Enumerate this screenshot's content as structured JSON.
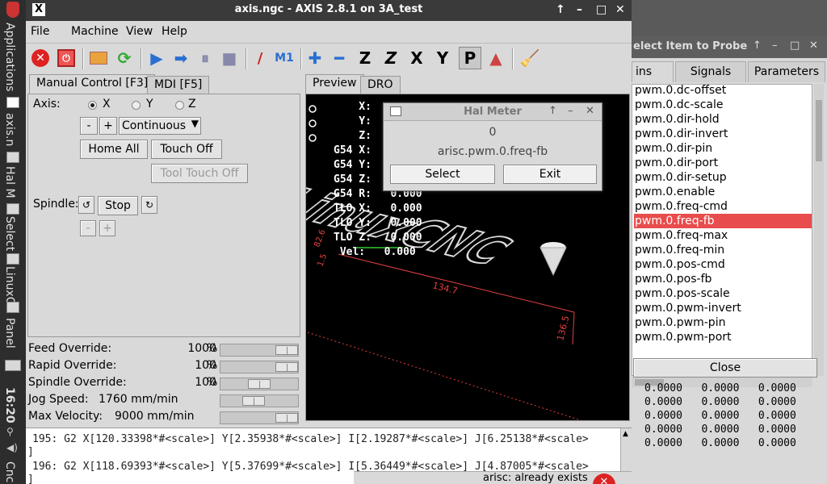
{
  "taskbar": {
    "items": [
      "Applications",
      "axis.n",
      "Hal M",
      "Select",
      "LinuxC",
      "Panel"
    ],
    "clock": "16:20",
    "last_item": "Cnc"
  },
  "axis": {
    "title": "axis.ngc - AXIS 2.8.1 on 3A_test",
    "menus": [
      "File",
      "Machine",
      "View",
      "Help"
    ],
    "toolbar_letters": {
      "z": "Z",
      "x": "X",
      "y": "Y",
      "p": "P"
    },
    "tabs": {
      "manual": "Manual Control [F3]",
      "mdi": "MDI [F5]",
      "preview": "Preview",
      "dro": "DRO"
    },
    "manual": {
      "axis_label": "Axis:",
      "axes": [
        "X",
        "Y",
        "Z"
      ],
      "minus": "-",
      "plus": "+",
      "jog_mode": "Continuous",
      "home_all": "Home All",
      "touch_off": "Touch Off",
      "tool_touch_off": "Tool Touch Off",
      "spindle_label": "Spindle:",
      "stop": "Stop",
      "spindle_minus": "-",
      "spindle_plus": "+"
    },
    "overrides": [
      {
        "label": "Feed Override:",
        "value": "1000",
        "unit": "%",
        "level": 1.0
      },
      {
        "label": "Rapid Override:",
        "value": "100",
        "unit": "%",
        "level": 1.0
      },
      {
        "label": "Spindle Override:",
        "value": "100",
        "unit": "%",
        "level": 0.5
      },
      {
        "label": "Jog Speed:",
        "value": "1760 mm/min",
        "unit": "",
        "level": 0.4
      },
      {
        "label": "Max Velocity:",
        "value": "9000 mm/min",
        "unit": "",
        "level": 1.0
      }
    ],
    "dro_lines": [
      "    X:",
      "    Y:",
      "    Z:",
      "G54 X:",
      "G54 Y:",
      "G54 Z:",
      "G54 R:   0.000",
      "TLO X:   0.000",
      "TLO Y:   0.000",
      "TLO Z:   0.000",
      " Vel:   0.000"
    ],
    "preview_labels": {
      "dim1": "134.7",
      "dim2": "136.5",
      "dim3": "1.5",
      "dim4": "82.6",
      "engrave": "LinuxCNC"
    },
    "gcode": [
      "195: G2 X[120.33398*#<scale>] Y[2.35938*#<scale>] I[2.19287*#<scale>] J[6.25138*#<scale>",
      "]",
      "196: G2 X[118.69393*#<scale>] Y[5.37699*#<scale>] I[5.36449*#<scale>] J[4.87005*#<scale>",
      "]"
    ]
  },
  "halmeter": {
    "title": "Hal Meter",
    "value": "0",
    "signal": "arisc.pwm.0.freq-fb",
    "select": "Select",
    "exit": "Exit"
  },
  "probe": {
    "title": "elect Item to Probe",
    "tabs": [
      "ins",
      "Signals",
      "Parameters"
    ],
    "items": [
      "pwm.0.dc-offset",
      "pwm.0.dc-scale",
      "pwm.0.dir-hold",
      "pwm.0.dir-invert",
      "pwm.0.dir-pin",
      "pwm.0.dir-port",
      "pwm.0.dir-setup",
      "pwm.0.enable",
      "pwm.0.freq-cmd",
      "pwm.0.freq-fb",
      "pwm.0.freq-max",
      "pwm.0.freq-min",
      "pwm.0.pos-cmd",
      "pwm.0.pos-fb",
      "pwm.0.pos-scale",
      "pwm.0.pwm-invert",
      "pwm.0.pwm-pin",
      "pwm.0.pwm-port"
    ],
    "selected_index": 9,
    "close": "Close",
    "nums": [
      "0.0000   0.0000   0.0000",
      "0.0000   0.0000   0.0000",
      "0.0000   0.0000   0.0000",
      "0.0000   0.0000   0.0000",
      "0.0000   0.0000   0.0000"
    ]
  },
  "notification": "arisc: already exists",
  "colors": {
    "selection": "#e84c4c",
    "preview_bg": "#000000",
    "dim_red": "#e04040"
  }
}
